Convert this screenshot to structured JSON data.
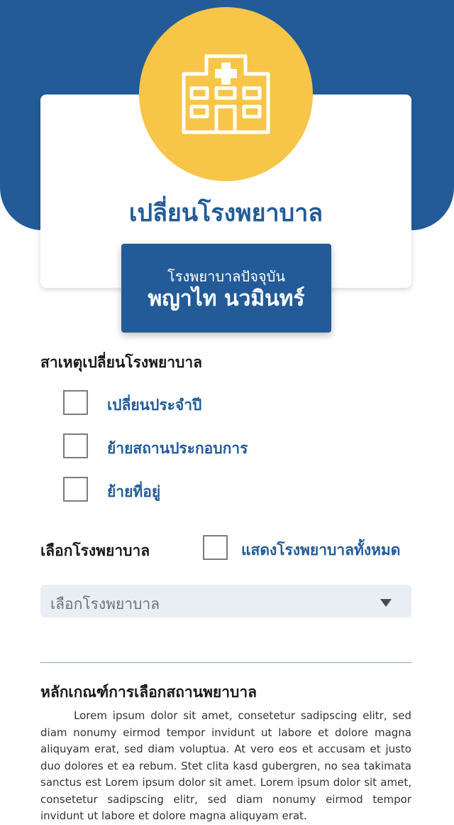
{
  "header": {
    "icon": "hospital-icon",
    "title": "เปลี่ยนโรงพยาบาล"
  },
  "current_hospital": {
    "label": "โรงพยาบาลปัจจุบัน",
    "name": "พญาไท นวมินทร์"
  },
  "reason": {
    "heading": "สาเหตุเปลี่ยนโรงพยาบาล",
    "options": [
      {
        "label": "เปลี่ยนประจำปี",
        "checked": false
      },
      {
        "label": "ย้ายสถานประกอบการ",
        "checked": false
      },
      {
        "label": "ย้ายที่อยู่",
        "checked": false
      }
    ]
  },
  "select_hospital": {
    "heading": "เลือกโรงพยาบาล",
    "show_all_label": "แสดงโรงพยาบาลทั้งหมด",
    "show_all_checked": false,
    "dropdown_value": "เลือกโรงพยาบาล"
  },
  "criteria": {
    "heading": "หลักเกณฑ์การเลือกสถานพยาบาล",
    "body": "Lorem ipsum dolor sit amet, consetetur sadipscing elitr, sed diam nonumy eirmod tempor invidunt ut labore et dolore magna aliquyam erat, sed diam voluptua. At vero eos et accusam et justo duo dolores et ea rebum. Stet clita kasd gubergren, no sea takimata sanctus est Lorem ipsum dolor sit amet. Lorem ipsum dolor sit amet, consetetur sadipscing elitr, sed diam nonumy eirmod tempor invidunt ut labore et dolore magna aliquyam erat."
  },
  "colors": {
    "primary": "#235b98",
    "accent": "#f7c548",
    "select_bg": "#e8eef4"
  }
}
